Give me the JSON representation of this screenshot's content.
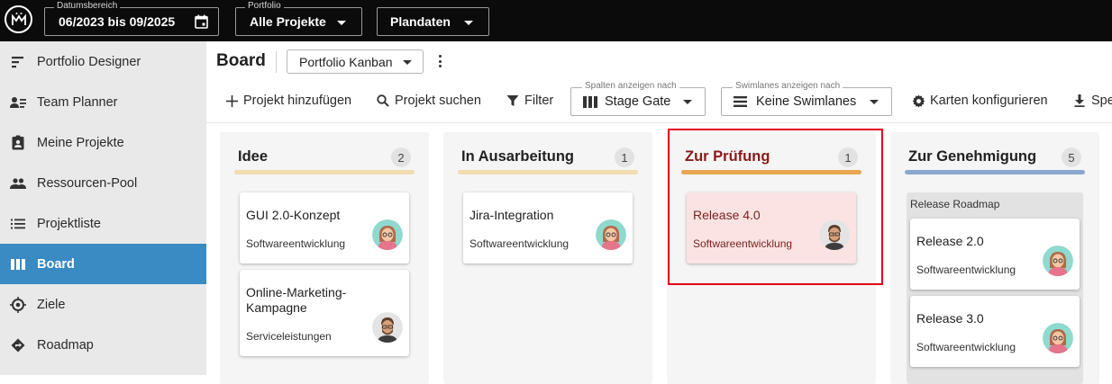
{
  "topbar": {
    "date_range": {
      "legend": "Datumsbereich",
      "value": "06/2023 bis 09/2025"
    },
    "portfolio": {
      "legend": "Portfolio",
      "value": "Alle Projekte"
    },
    "dataset": {
      "value": "Plandaten"
    }
  },
  "sidebar": {
    "items": [
      {
        "label": "Portfolio Designer",
        "icon": "portfolio-designer-icon"
      },
      {
        "label": "Team Planner",
        "icon": "team-planner-icon"
      },
      {
        "label": "Meine Projekte",
        "icon": "my-projects-icon"
      },
      {
        "label": "Ressourcen-Pool",
        "icon": "resource-pool-icon"
      },
      {
        "label": "Projektliste",
        "icon": "list-icon"
      },
      {
        "label": "Board",
        "icon": "board-icon",
        "active": true
      },
      {
        "label": "Ziele",
        "icon": "target-icon"
      },
      {
        "label": "Roadmap",
        "icon": "roadmap-icon"
      }
    ]
  },
  "header": {
    "title": "Board",
    "view": "Portfolio Kanban"
  },
  "toolbar": {
    "add_project": "Projekt hinzufügen",
    "search_project": "Projekt suchen",
    "filter": "Filter",
    "columns": {
      "legend": "Spalten anzeigen nach",
      "value": "Stage Gate"
    },
    "swimlanes": {
      "legend": "Swimlanes anzeigen nach",
      "value": "Keine Swimlanes"
    },
    "configure_cards": "Karten konfigurieren",
    "save": "Spe"
  },
  "board": {
    "columns": [
      {
        "title": "Idee",
        "count": "2",
        "bar_color": "#f0ddb0",
        "cards": [
          {
            "title": "GUI 2.0-Konzept",
            "subtitle": "Softwareentwicklung",
            "avatar": "woman-avatar"
          },
          {
            "title": "Online-Marketing-Kampagne",
            "subtitle": "Serviceleistungen",
            "avatar": "man-avatar"
          }
        ]
      },
      {
        "title": "In Ausarbeitung",
        "count": "1",
        "bar_color": "#f0ddb0",
        "cards": [
          {
            "title": "Jira-Integration",
            "subtitle": "Softwareentwicklung",
            "avatar": "woman-avatar"
          }
        ]
      },
      {
        "title": "Zur Prüfung",
        "count": "1",
        "bar_color": "#e8a650",
        "highlighted": true,
        "cards": [
          {
            "title": "Release 4.0",
            "subtitle": "Softwareentwicklung",
            "avatar": "man-avatar"
          }
        ]
      },
      {
        "title": "Zur Genehmigung",
        "count": "5",
        "bar_color": "#8aa7cc",
        "group": "Release Roadmap",
        "cards": [
          {
            "title": "Release 2.0",
            "subtitle": "Softwareentwicklung",
            "avatar": "woman-avatar"
          },
          {
            "title": "Release 3.0",
            "subtitle": "Softwareentwicklung",
            "avatar": "woman-avatar"
          }
        ]
      }
    ]
  }
}
